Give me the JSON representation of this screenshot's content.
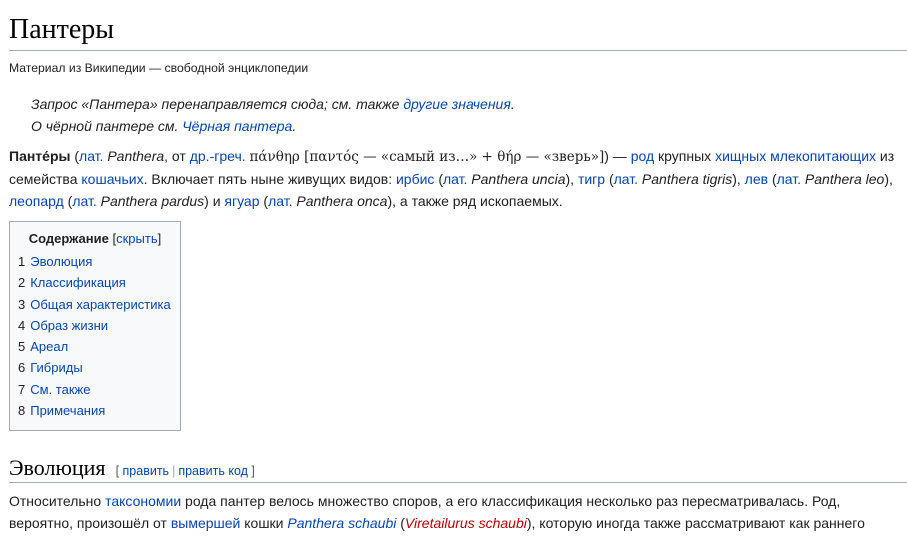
{
  "page": {
    "title": "Пантеры",
    "subtitle": "Материал из Википедии — свободной энциклопедии"
  },
  "hatnotes": {
    "line1_prefix": "Запрос «Пантера» перенаправляется сюда; см. также ",
    "line1_link": "другие значения",
    "line1_suffix": ".",
    "line2_prefix": "О чёрной пантере см. ",
    "line2_link": "Чёрная пантера",
    "line2_suffix": "."
  },
  "intro": {
    "t0": "Панте́ры",
    "t1": " (",
    "l_lat1": "лат.",
    "t2": " ",
    "i_panthera": "Panthera",
    "t3": ", от ",
    "l_greek": "др.-греч.",
    "t4": " ",
    "greek1": "πάνθηρ [παντός — «самый из…» + θήρ — «зверь»]",
    "t5": ") — ",
    "l_rod": "род",
    "t6": " крупных ",
    "l_hishchnyh": "хищных",
    "t7": " ",
    "l_mlekopit": "млекопитающих",
    "t8": " из семейства ",
    "l_koshachyh": "кошачьих",
    "t9": ". Включает пять ныне живущих видов: ",
    "l_irbis": "ирбис",
    "t10": " (",
    "l_lat2": "лат.",
    "t11": " ",
    "i_uncia": "Panthera uncia",
    "t12": "), ",
    "l_tigr": "тигр",
    "t13": " (",
    "l_lat3": "лат.",
    "t14": " ",
    "i_tigris": "Panthera tigris",
    "t15": "), ",
    "l_lev": "лев",
    "t16": " (",
    "l_lat4": "лат.",
    "t17": " ",
    "i_leo": "Panthera leo",
    "t18": "), ",
    "l_leopard": "леопард",
    "t19": " (",
    "l_lat5": "лат.",
    "t20": " ",
    "i_pardus": "Panthera pardus",
    "t21": ") и ",
    "l_yaguar": "ягуар",
    "t22": " (",
    "l_lat6": "лат.",
    "t23": " ",
    "i_onca": "Panthera onca",
    "t24": "), а также ряд ископаемых."
  },
  "toc": {
    "title": "Содержание",
    "toggle_open": "[",
    "toggle": "скрыть",
    "toggle_close": "]",
    "items": [
      {
        "num": "1",
        "label": "Эволюция"
      },
      {
        "num": "2",
        "label": "Классификация"
      },
      {
        "num": "3",
        "label": "Общая характеристика"
      },
      {
        "num": "4",
        "label": "Образ жизни"
      },
      {
        "num": "5",
        "label": "Ареал"
      },
      {
        "num": "6",
        "label": "Гибриды"
      },
      {
        "num": "7",
        "label": "См. также"
      },
      {
        "num": "8",
        "label": "Примечания"
      }
    ]
  },
  "section": {
    "heading": "Эволюция",
    "bracket_open": "[",
    "edit": "править",
    "sep": "|",
    "edit_code": "править код",
    "bracket_close": "]"
  },
  "evolution_para": {
    "t0": "Относительно ",
    "l_taxonomy": "таксономии",
    "t1": " рода пантер велось множество споров, а его классификация несколько раз пересматривалась. Род, вероятно, произошёл от ",
    "l_extinct": "вымершей",
    "t2": " кошки ",
    "l_schaubi": "Panthera schaubi",
    "t3": " (",
    "l_viretailurus": "Viretailurus schaubi",
    "t4": "), которую иногда также рассматривают как раннего"
  },
  "colors": {
    "link": "#0645ad",
    "red_link": "#ba0000",
    "text": "#202122",
    "rule": "#a2a9b1"
  }
}
